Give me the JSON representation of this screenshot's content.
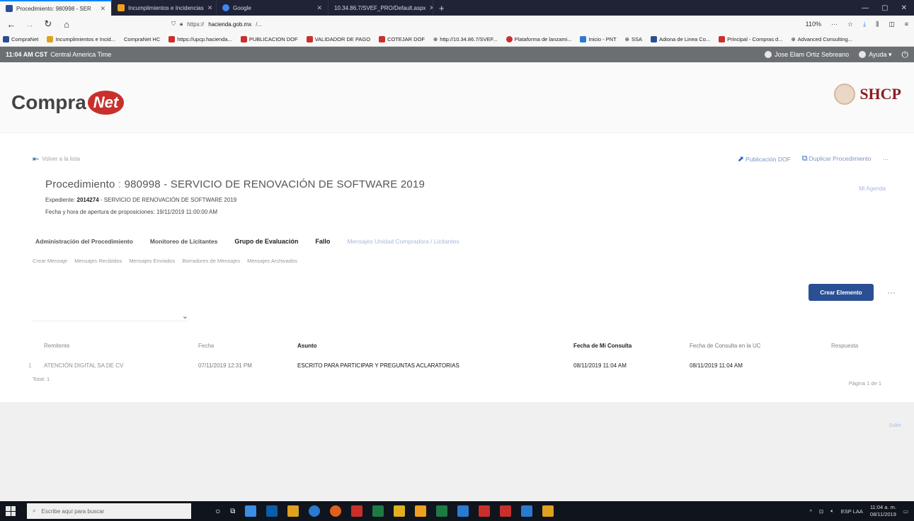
{
  "browser": {
    "tabs": [
      {
        "label": "Procedimiento: 980998 - SER",
        "favicon_color": "#2a4f94",
        "active": true
      },
      {
        "label": "Incumplimientos e Incidencias",
        "favicon_color": "#f0a020",
        "active": false
      },
      {
        "label": "Google",
        "favicon_color": "#4285f4",
        "active": false
      },
      {
        "label": "10.34.86.7/SVEF_PRO/Default.aspx",
        "favicon_color": "#888888",
        "active": false
      }
    ],
    "new_tab_label": "+",
    "nav": {
      "url_prefix": "https://",
      "url_host": "hacienda.gob.mx",
      "url_rest": "/...",
      "zoom": "110%",
      "more": "···",
      "bookmark": "☆"
    },
    "bookmarks": [
      {
        "label": "CompraNet",
        "color": "#2a4f94"
      },
      {
        "label": "Incumplimientos e Incid...",
        "color": "#e0a020"
      },
      {
        "label": "CompraNet HC",
        "color": "#2a4f94"
      },
      {
        "label": "https://upcp.hacienda...",
        "color": "#c9302c"
      },
      {
        "label": "PUBLICACION DOF",
        "color": "#c9302c"
      },
      {
        "label": "VALIDADOR DE PAGO",
        "color": "#c9302c"
      },
      {
        "label": "COTEJAR DOF",
        "color": "#c9302c"
      },
      {
        "label": "http://10.34.86.7/SVEF...",
        "color": "#555555"
      },
      {
        "label": "Plataforma de lanzami...",
        "color": "#c9302c"
      },
      {
        "label": "Inicio - PNT",
        "color": "#2a7bd0"
      },
      {
        "label": "SSA",
        "color": "#555555"
      },
      {
        "label": "Adiona de Linea Co...",
        "color": "#2a4f94"
      },
      {
        "label": "Principal - Compras d...",
        "color": "#c9302c"
      },
      {
        "label": "Advanced Consulting...",
        "color": "#555555"
      }
    ]
  },
  "app_bar": {
    "time": "11:04 AM CST",
    "zone": "Central America Time",
    "user": "Jose Elam Ortiz Sebreano",
    "help": "Ayuda",
    "power_icon": "power-icon"
  },
  "header": {
    "logo_text": "Compra",
    "logo_badge": "Net",
    "agency": "SHCP"
  },
  "page": {
    "back_label": "Volver a la lista",
    "actions": [
      {
        "label": "Publicación DOF",
        "icon": "publish-icon"
      },
      {
        "label": "Duplicar Procedimiento",
        "icon": "copy-icon"
      }
    ],
    "actions_more": "···",
    "title_prefix": "Procedimiento",
    "title_sep": " : ",
    "title_main": "980998 - SERVICIO DE RENOVACIÓN DE SOFTWARE 2019",
    "ref_label": "Mi Agenda",
    "expediente_label": "Expediente:",
    "expediente_num": "2014274",
    "expediente_desc": " - SERVICIO DE RENOVACIÓN DE SOFTWARE 2019",
    "apertura": "Fecha y hora de apertura de proposiciones: 19/11/2019 11:00:00 AM"
  },
  "tabs": [
    {
      "label": "Administración del Procedimiento",
      "style": "bold"
    },
    {
      "label": "Monitoreo de Licitantes",
      "style": "bold"
    },
    {
      "label": "Grupo de Evaluación",
      "style": "dark"
    },
    {
      "label": "Fallo",
      "style": "dark"
    },
    {
      "label": "Mensajes Unidad Compradora / Licitantes",
      "style": "light"
    }
  ],
  "subtabs": [
    "Crear Mensaje",
    "Mensajes Recibidos",
    "Mensajes Enviados",
    "Borradores de Mensajes",
    "Mensajes Archivados"
  ],
  "toolbar": {
    "create_label": "Crear Elemento",
    "more": "···"
  },
  "filter": {
    "label": "",
    "chevron": "⌄"
  },
  "table": {
    "columns": [
      "Remitente",
      "Fecha",
      "Asunto",
      "Fecha de Mi Consulta",
      "Fecha de Consulta en la UC",
      "Respuesta"
    ],
    "rows": [
      {
        "num": "1",
        "remitente": "ATENCIÓN DIGITAL SA DE CV",
        "fecha": "07/11/2019 12:31 PM",
        "asunto": "ESCRITO PARA PARTICIPAR Y PREGUNTAS ACLARATORIAS",
        "mi_consulta": "08/11/2019 11:04 AM",
        "consulta_uc": "08/11/2019 11:04 AM",
        "respuesta": ""
      }
    ],
    "total": "Total: 1",
    "pager": "Página 1 de 1"
  },
  "footer": {
    "link": "Subir"
  },
  "taskbar": {
    "search_placeholder": "Escribe aquí para buscar",
    "apps": [
      "#ffffff",
      "#3a8ee6",
      "#0a5ea8",
      "#e0a020",
      "#2a7bd0",
      "#e06020",
      "#c9302c",
      "#1d7a45",
      "#e0b020",
      "#f0a020",
      "#1d7a45",
      "#2a7bd0",
      "#c9302c",
      "#c9302c",
      "#2a7bd0",
      "#e0a020"
    ],
    "lang": "ESP LAA",
    "time": "11:04 a. m.",
    "date": "08/11/2019"
  }
}
